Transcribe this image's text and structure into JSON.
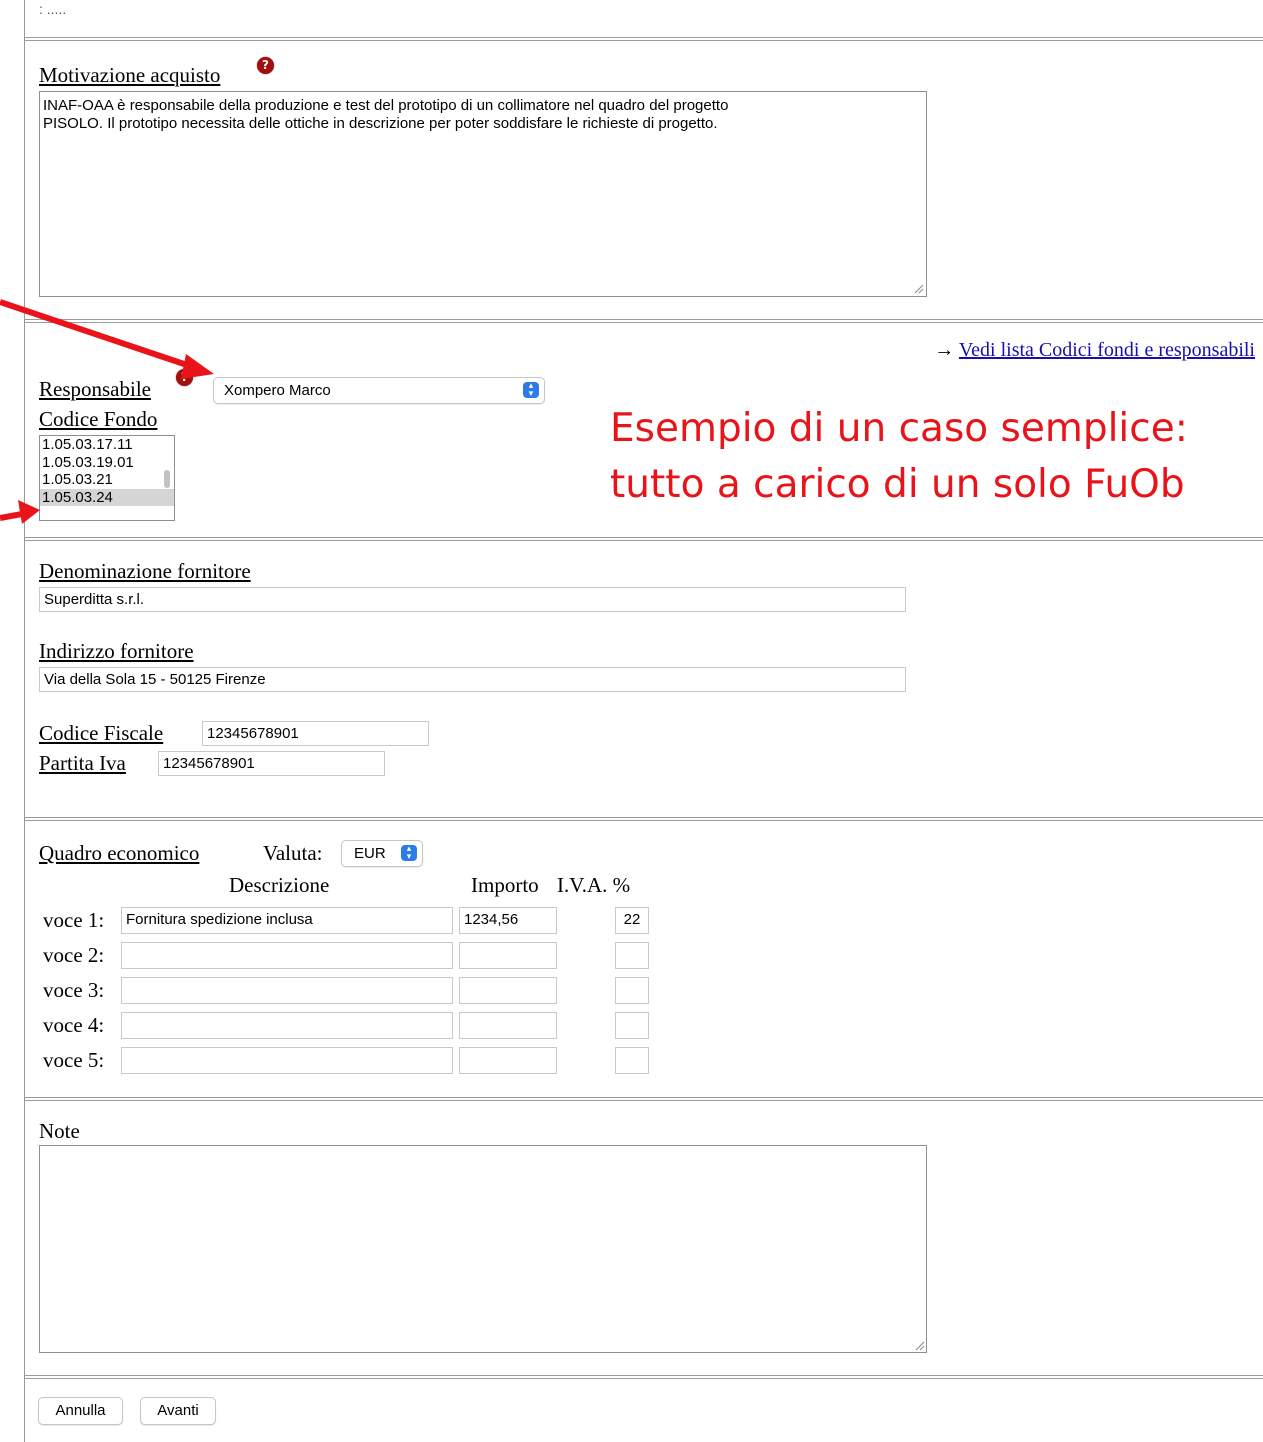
{
  "top": {
    "residual_text": ": ....."
  },
  "motivazione": {
    "label": "Motivazione acquisto",
    "help": "?",
    "text_line1": "INAF-OAA è responsabile della produzione e test del prototipo di un collimatore nel quadro del progetto",
    "text_line2": "PISOLO. Il prototipo necessita delle ottiche in descrizione per poter soddisfare le richieste di progetto."
  },
  "responsabile": {
    "link_arrow": "→",
    "link_text": "Vedi lista Codici fondi e responsabili",
    "label": "Responsabile",
    "help": "?",
    "selected": "Xompero Marco",
    "codice_label": "Codice Fondo",
    "codici": [
      "1.05.03.17.11",
      "1.05.03.19.01",
      "1.05.03.21",
      "1.05.03.24"
    ],
    "codice_selected": "1.05.03.24"
  },
  "annotation": {
    "line1": "Esempio di un caso semplice:",
    "line2": "tutto a carico di un solo FuOb",
    "color": "#e8141a"
  },
  "fornitore": {
    "denominazione_label": "Denominazione fornitore",
    "denominazione_value": "Superditta s.r.l.",
    "indirizzo_label": "Indirizzo fornitore",
    "indirizzo_value": "Via della Sola 15 - 50125 Firenze",
    "cf_label": "Codice Fiscale",
    "cf_value": "12345678901",
    "piva_label": "Partita Iva",
    "piva_value": "12345678901"
  },
  "quadro": {
    "label": "Quadro economico",
    "valuta_label": "Valuta:",
    "valuta_value": "EUR",
    "col_descrizione": "Descrizione",
    "col_importo": "Importo",
    "col_iva": "I.V.A. %",
    "rows": [
      {
        "label": "voce 1:",
        "descrizione": "Fornitura spedizione inclusa",
        "importo": "1234,56",
        "iva": "22"
      },
      {
        "label": "voce 2:",
        "descrizione": "",
        "importo": "",
        "iva": ""
      },
      {
        "label": "voce 3:",
        "descrizione": "",
        "importo": "",
        "iva": ""
      },
      {
        "label": "voce 4:",
        "descrizione": "",
        "importo": "",
        "iva": ""
      },
      {
        "label": "voce 5:",
        "descrizione": "",
        "importo": "",
        "iva": ""
      }
    ]
  },
  "note": {
    "label": "Note",
    "value": ""
  },
  "buttons": {
    "annulla": "Annulla",
    "avanti": "Avanti"
  }
}
